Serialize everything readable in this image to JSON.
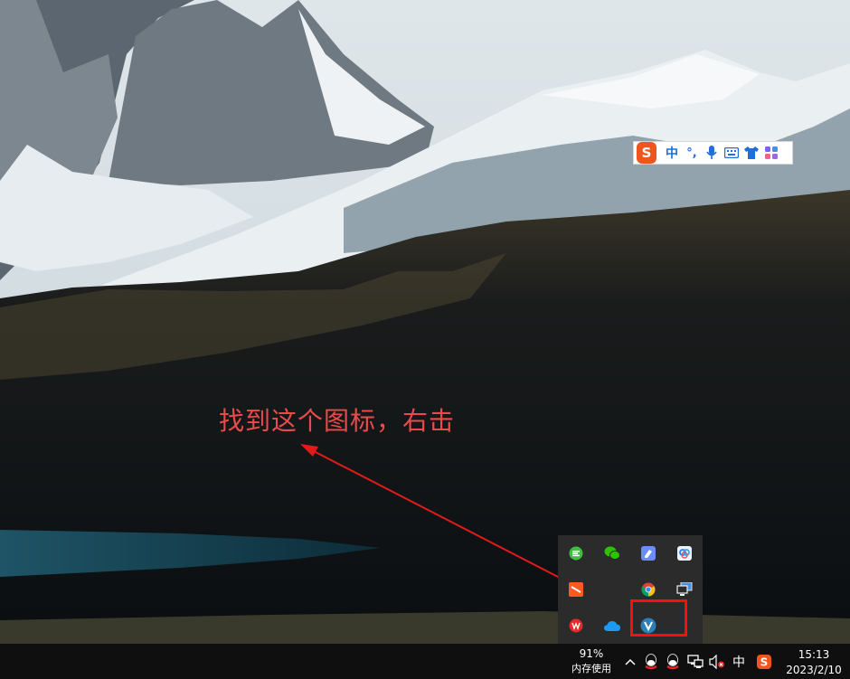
{
  "annotation": {
    "text": "找到这个图标，右击"
  },
  "ime_toolbar": {
    "logo_letter": "S",
    "mode": "中",
    "punct": "°,",
    "icons": [
      "microphone-icon",
      "keyboard-icon",
      "skin-icon",
      "toolbox-icon"
    ]
  },
  "tray_popup": {
    "icons": [
      [
        "green-app-icon",
        "wechat-icon",
        "blue-note-icon",
        "baidu-netdisk-icon"
      ],
      [
        "orange-app-icon",
        "empty",
        "chrome-icon",
        "remote-desktop-icon"
      ],
      [
        "red-app-icon",
        "onedrive-icon",
        "v-app-icon",
        "empty"
      ]
    ],
    "highlighted": "v-app-icon"
  },
  "taskbar": {
    "memory_percent": "91%",
    "memory_label": "内存使用",
    "ime_indicator": "中",
    "tray_icons": [
      "qq-icon",
      "qq-icon",
      "network-icon",
      "volume-muted-icon",
      "sogou-tray-icon"
    ],
    "time": "15:13",
    "date": "2023/2/10"
  },
  "colors": {
    "annotation": "#e94b4b",
    "highlight": "#ff0c0c",
    "taskbar": "#0f0f0f",
    "popup": "#2b2b2b"
  }
}
